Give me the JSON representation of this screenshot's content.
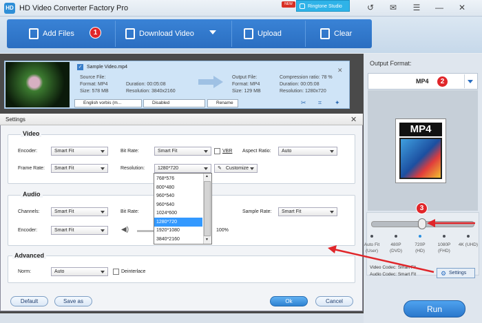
{
  "app": {
    "title": "HD Video Converter Factory Pro",
    "new_badge": "NEW",
    "ringtone": "Ringtone Studio"
  },
  "toolbar": {
    "add_files": "Add Files",
    "download_video": "Download Video",
    "upload": "Upload",
    "clear": "Clear",
    "step1": "1"
  },
  "file": {
    "name": "Sample Video.mp4",
    "source_label": "Source File:",
    "src_format": "Format: MP4",
    "src_size": "Size: 578 MB",
    "src_duration": "Duration: 00:05:08",
    "src_resolution": "Resolution: 3840x2160",
    "output_label": "Output File:",
    "out_format": "Format: MP4",
    "out_size": "Size: 129 MB",
    "out_duration": "Duration: 00:05:08",
    "out_resolution": "Resolution: 1280x720",
    "compression": "Compression ratio: 78 %",
    "audio_track": "English vorbis (m...",
    "subtitle": "Disabled",
    "rename": "Rename"
  },
  "output": {
    "label": "Output Format:",
    "format": "MP4",
    "step2": "2",
    "step3": "3",
    "icon_text": "MP4"
  },
  "quality": {
    "levels": [
      "Auto Fit (User)",
      "480P (DVD)",
      "720P (HD)",
      "1080P (FHD)",
      "4K (UHD)"
    ],
    "selected": "720P (HD)",
    "slider_position_fraction": 0.48
  },
  "codecs": {
    "video": "Video Codec: Smart Fit",
    "audio": "Audio Codec: Smart Fit"
  },
  "settings_btn": "Settings",
  "run": "Run",
  "dialog": {
    "title": "Settings",
    "close": "✕",
    "video": {
      "header": "Video",
      "encoder_label": "Encoder:",
      "encoder": "Smart Fit",
      "bitrate_label": "Bit Rate:",
      "bitrate": "Smart Fit",
      "vbr": "VBR",
      "aspect_label": "Aspect Ratio:",
      "aspect": "Auto",
      "framerate_label": "Frame Rate:",
      "framerate": "Smart Fit",
      "resolution_label": "Resolution:",
      "resolution": "1280*720",
      "customize": "Customize"
    },
    "resolution_options": [
      "768*576",
      "800*480",
      "960*540",
      "960*640",
      "1024*600",
      "1280*720",
      "1920*1080",
      "3840*2160"
    ],
    "resolution_selected": "1280*720",
    "audio": {
      "header": "Audio",
      "channels_label": "Channels:",
      "channels": "Smart Fit",
      "bitrate_label": "Bit Rate:",
      "samplerate_label": "Sample Rate:",
      "samplerate": "Smart Fit",
      "encoder_label": "Encoder:",
      "encoder": "Smart Fit",
      "volume": "100%"
    },
    "advanced": {
      "header": "Advanced",
      "norm_label": "Norm:",
      "norm": "Auto",
      "deinterlace": "Deinterlace"
    },
    "buttons": {
      "default": "Default",
      "save_as": "Save as",
      "ok": "Ok",
      "cancel": "Cancel"
    }
  },
  "colors": {
    "accent": "#2a6ec1",
    "annotation": "#e0262a"
  }
}
